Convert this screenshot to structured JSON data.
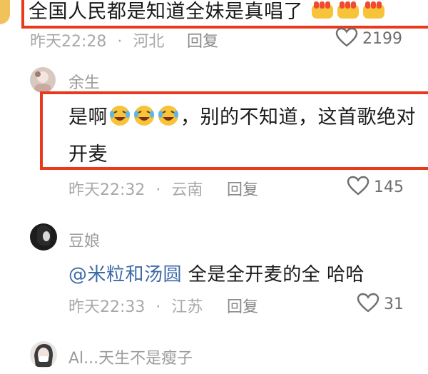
{
  "comments": [
    {
      "text": "全国人民都是知道全妹是真唱了",
      "time": "昨天22:28",
      "location": "河北",
      "reply_label": "回复",
      "likes": "2199",
      "emoji": [
        "fist-emoji",
        "fist-emoji",
        "fist-emoji"
      ]
    },
    {
      "username": "余生",
      "text_part1": "是啊",
      "text_part2": "，别的不知道，这首歌绝对",
      "text_line2": "开麦",
      "emoji": [
        "laughing-tears-emoji",
        "laughing-tears-emoji",
        "laughing-tears-emoji"
      ],
      "time": "昨天22:32",
      "location": "云南",
      "reply_label": "回复",
      "likes": "145"
    },
    {
      "username": "豆娘",
      "mention": "@米粒和汤圆",
      "text": " 全是全开麦的全 哈哈",
      "time": "昨天22:33",
      "location": "江苏",
      "reply_label": "回复",
      "likes": "31"
    },
    {
      "username": "Al...天生不是瘦子"
    }
  ],
  "dot_separator": "·",
  "colors": {
    "highlight": "#e8391d",
    "mention": "#3d6aa8",
    "meta": "#a8a8a8"
  }
}
